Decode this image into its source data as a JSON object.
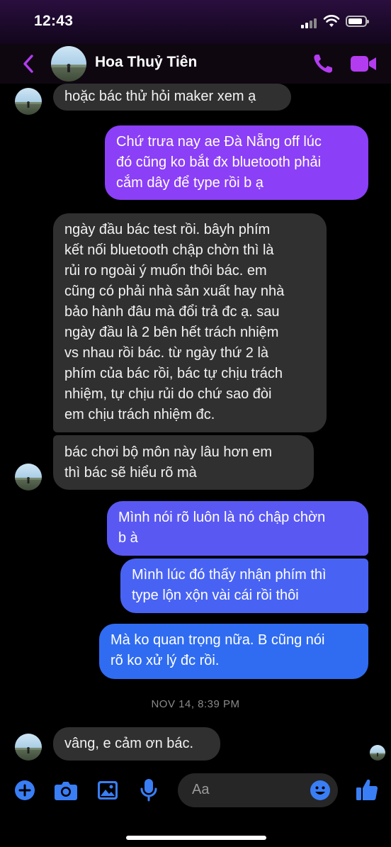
{
  "status_bar": {
    "time": "12:43",
    "signal_icon": "cellular-signal-icon",
    "wifi_icon": "wifi-icon",
    "battery_icon": "battery-icon"
  },
  "header": {
    "contact_name": "Hoa Thuỷ Tiên",
    "back_icon": "chevron-left-icon",
    "call_icon": "phone-icon",
    "video_icon": "video-camera-icon"
  },
  "messages": [
    {
      "direction": "incoming",
      "lines": [
        "hoặc bác thử hỏi maker xem ạ"
      ]
    },
    {
      "direction": "outgoing",
      "lines": [
        "Chứ trưa nay ae Đà Nẵng off lúc",
        "đó cũng ko bắt đx bluetooth phải",
        "cắm dây để type rồi b ạ"
      ]
    },
    {
      "direction": "incoming",
      "lines": [
        "ngày đầu bác test rồi. bâyh phím",
        "kết nối bluetooth chập chờn thì là",
        "rủi ro ngoài ý muốn thôi bác. em",
        "cũng có phải nhà sản xuất hay nhà",
        "bảo hành đâu mà đổi trả đc ạ. sau",
        "ngày đầu là 2 bên hết trách nhiệm",
        "vs nhau rồi bác. từ ngày thứ 2 là",
        "phím của bác rồi, bác tự chịu trách",
        "nhiệm, tự chịu rủi do chứ sao đòi",
        "em chịu trách nhiệm đc."
      ]
    },
    {
      "direction": "incoming",
      "lines": [
        "bác chơi bộ môn này lâu hơn em",
        "thì bác sẽ hiểu rõ mà"
      ]
    },
    {
      "direction": "outgoing",
      "lines": [
        "Mình nói rõ luôn là nó chập chờn",
        "b à"
      ]
    },
    {
      "direction": "outgoing",
      "lines": [
        "Mình lúc đó thấy nhận phím thì",
        "type lộn xộn vài cái rồi thôi"
      ]
    },
    {
      "direction": "outgoing",
      "lines": [
        "Mà ko quan trọng nữa. B cũng nói",
        "rõ ko xử lý đc rồi."
      ]
    },
    {
      "direction": "incoming",
      "lines": [
        "vâng, e cảm ơn bác."
      ]
    }
  ],
  "timestamp": "NOV 14, 8:39 PM",
  "composer": {
    "placeholder": "Aa",
    "icons": [
      "plus-circle-icon",
      "camera-icon",
      "photo-icon",
      "microphone-icon",
      "emoji-icon",
      "thumbs-up-icon"
    ]
  },
  "colors": {
    "accent": "#b43cf0",
    "incoming_bubble": "#303030",
    "grad_top": "#8b3ff6",
    "grad_bottom": "#2f6cf1",
    "composer_icon": "#3a7ef5"
  }
}
